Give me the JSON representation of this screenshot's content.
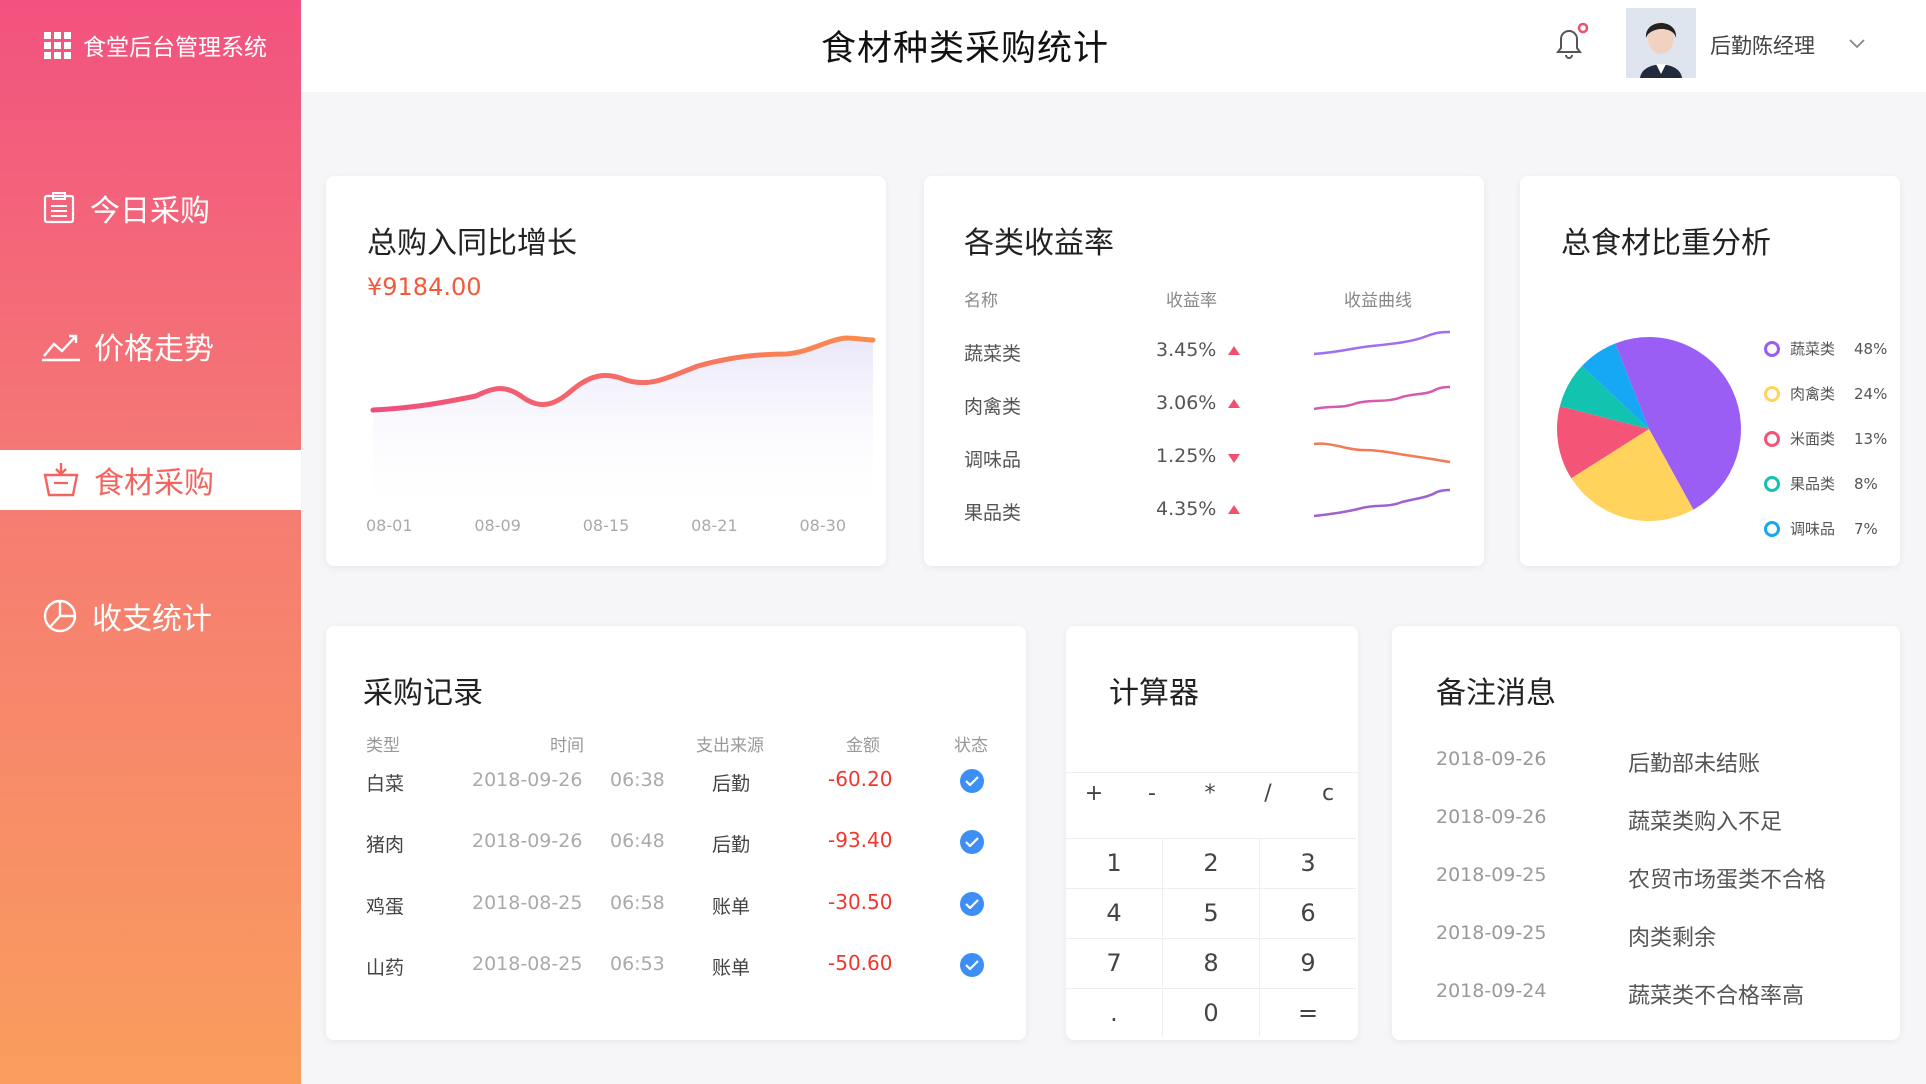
{
  "app": {
    "title": "食堂后台管理系统"
  },
  "nav": {
    "items": [
      {
        "label": "今日采购",
        "icon": "clipboard-icon"
      },
      {
        "label": "价格走势",
        "icon": "trend-line-icon"
      },
      {
        "label": "食材采购",
        "icon": "basket-icon",
        "active": true
      },
      {
        "label": "收支统计",
        "icon": "pie-chart-icon"
      }
    ]
  },
  "header": {
    "page_title": "食材种类采购统计",
    "username": "后勤陈经理",
    "notification_dot": true
  },
  "growth": {
    "title": "总购入同比增长",
    "amount": "¥9184.00",
    "x_labels": [
      "08-01",
      "08-09",
      "08-15",
      "08-21",
      "08-30"
    ]
  },
  "profit": {
    "title": "各类收益率",
    "headers": {
      "name": "名称",
      "rate": "收益率",
      "curve": "收益曲线"
    },
    "rows": [
      {
        "name": "蔬菜类",
        "rate": "3.45%",
        "trend": "up",
        "color": "#a06ef0"
      },
      {
        "name": "肉禽类",
        "rate": "3.06%",
        "trend": "up",
        "color": "#d65ab0"
      },
      {
        "name": "调味品",
        "rate": "1.25%",
        "trend": "down",
        "color": "#f37a55"
      },
      {
        "name": "果品类",
        "rate": "4.35%",
        "trend": "up",
        "color": "#a060d0"
      }
    ]
  },
  "ratio": {
    "title": "总食材比重分析",
    "chart_data": {
      "type": "pie",
      "categories": [
        "蔬菜类",
        "肉禽类",
        "米面类",
        "果品类",
        "调味品"
      ],
      "values": [
        48,
        24,
        13,
        8,
        7
      ],
      "labels": [
        "48%",
        "24%",
        "13%",
        "8%",
        "7%"
      ],
      "colors": [
        "#9b5ef5",
        "#ffd35c",
        "#f45577",
        "#12c4b0",
        "#16a8f4"
      ],
      "legend": "right"
    }
  },
  "records": {
    "title": "采购记录",
    "headers": {
      "type": "类型",
      "time": "时间",
      "source": "支出来源",
      "amount": "金额",
      "status": "状态"
    },
    "rows": [
      {
        "type": "白菜",
        "date": "2018-09-26",
        "clock": "06:38",
        "source": "后勤",
        "amount": "-60.20"
      },
      {
        "type": "猪肉",
        "date": "2018-09-26",
        "clock": "06:48",
        "source": "后勤",
        "amount": "-93.40"
      },
      {
        "type": "鸡蛋",
        "date": "2018-08-25",
        "clock": "06:58",
        "source": "账单",
        "amount": "-30.50"
      },
      {
        "type": "山药",
        "date": "2018-08-25",
        "clock": "06:53",
        "source": "账单",
        "amount": "-50.60"
      }
    ]
  },
  "calculator": {
    "title": "计算器",
    "ops": [
      "+",
      "-",
      "*",
      "/",
      "c"
    ],
    "rows": [
      [
        "1",
        "2",
        "3"
      ],
      [
        "4",
        "5",
        "6"
      ],
      [
        "7",
        "8",
        "9"
      ],
      [
        ".",
        "0",
        "="
      ]
    ]
  },
  "notes": {
    "title": "备注消息",
    "items": [
      {
        "date": "2018-09-26",
        "text": "后勤部未结账"
      },
      {
        "date": "2018-09-26",
        "text": "蔬菜类购入不足"
      },
      {
        "date": "2018-09-25",
        "text": "农贸市场蛋类不合格"
      },
      {
        "date": "2018-09-25",
        "text": "肉类剩余"
      },
      {
        "date": "2018-09-24",
        "text": "蔬菜类不合格率高"
      }
    ]
  },
  "annotations": [
    "520px",
    "76px",
    "41px",
    "45px",
    "25px",
    "26px",
    "272px",
    "40px",
    "66px",
    "38px",
    "392px",
    "30px",
    "44px",
    "42px",
    "34px",
    "167px",
    "126px",
    "71px",
    "36px",
    "36px",
    "131px",
    "77px",
    "41px",
    "34px",
    "31px",
    "46px",
    "52px",
    "132px",
    "44px",
    "129px",
    "41px",
    "16px",
    "181px",
    "11px",
    "22px",
    "13px",
    "19p",
    "25px",
    "114px",
    "379px",
    "34px",
    "53px",
    "37px",
    "42px",
    "105px",
    "42px",
    "147px",
    "109px",
    "77px",
    "73px",
    "37px",
    "70px",
    "46px",
    "414px",
    "42px",
    "48px",
    "85px",
    "62px",
    "699px",
    "60px",
    "41px",
    "43px",
    "42px",
    "146px",
    "23px",
    "43px",
    "42px",
    "43px",
    "18px",
    "14px",
    "37px",
    "289px",
    "93px",
    "46px",
    "46px",
    "59px",
    "100px",
    "40px",
    "42px",
    "44px",
    "115px",
    "32px",
    "51px",
    "128px",
    "36px",
    "77px",
    "109px",
    "44px",
    "62px",
    "180px",
    "86px",
    "38px"
  ]
}
